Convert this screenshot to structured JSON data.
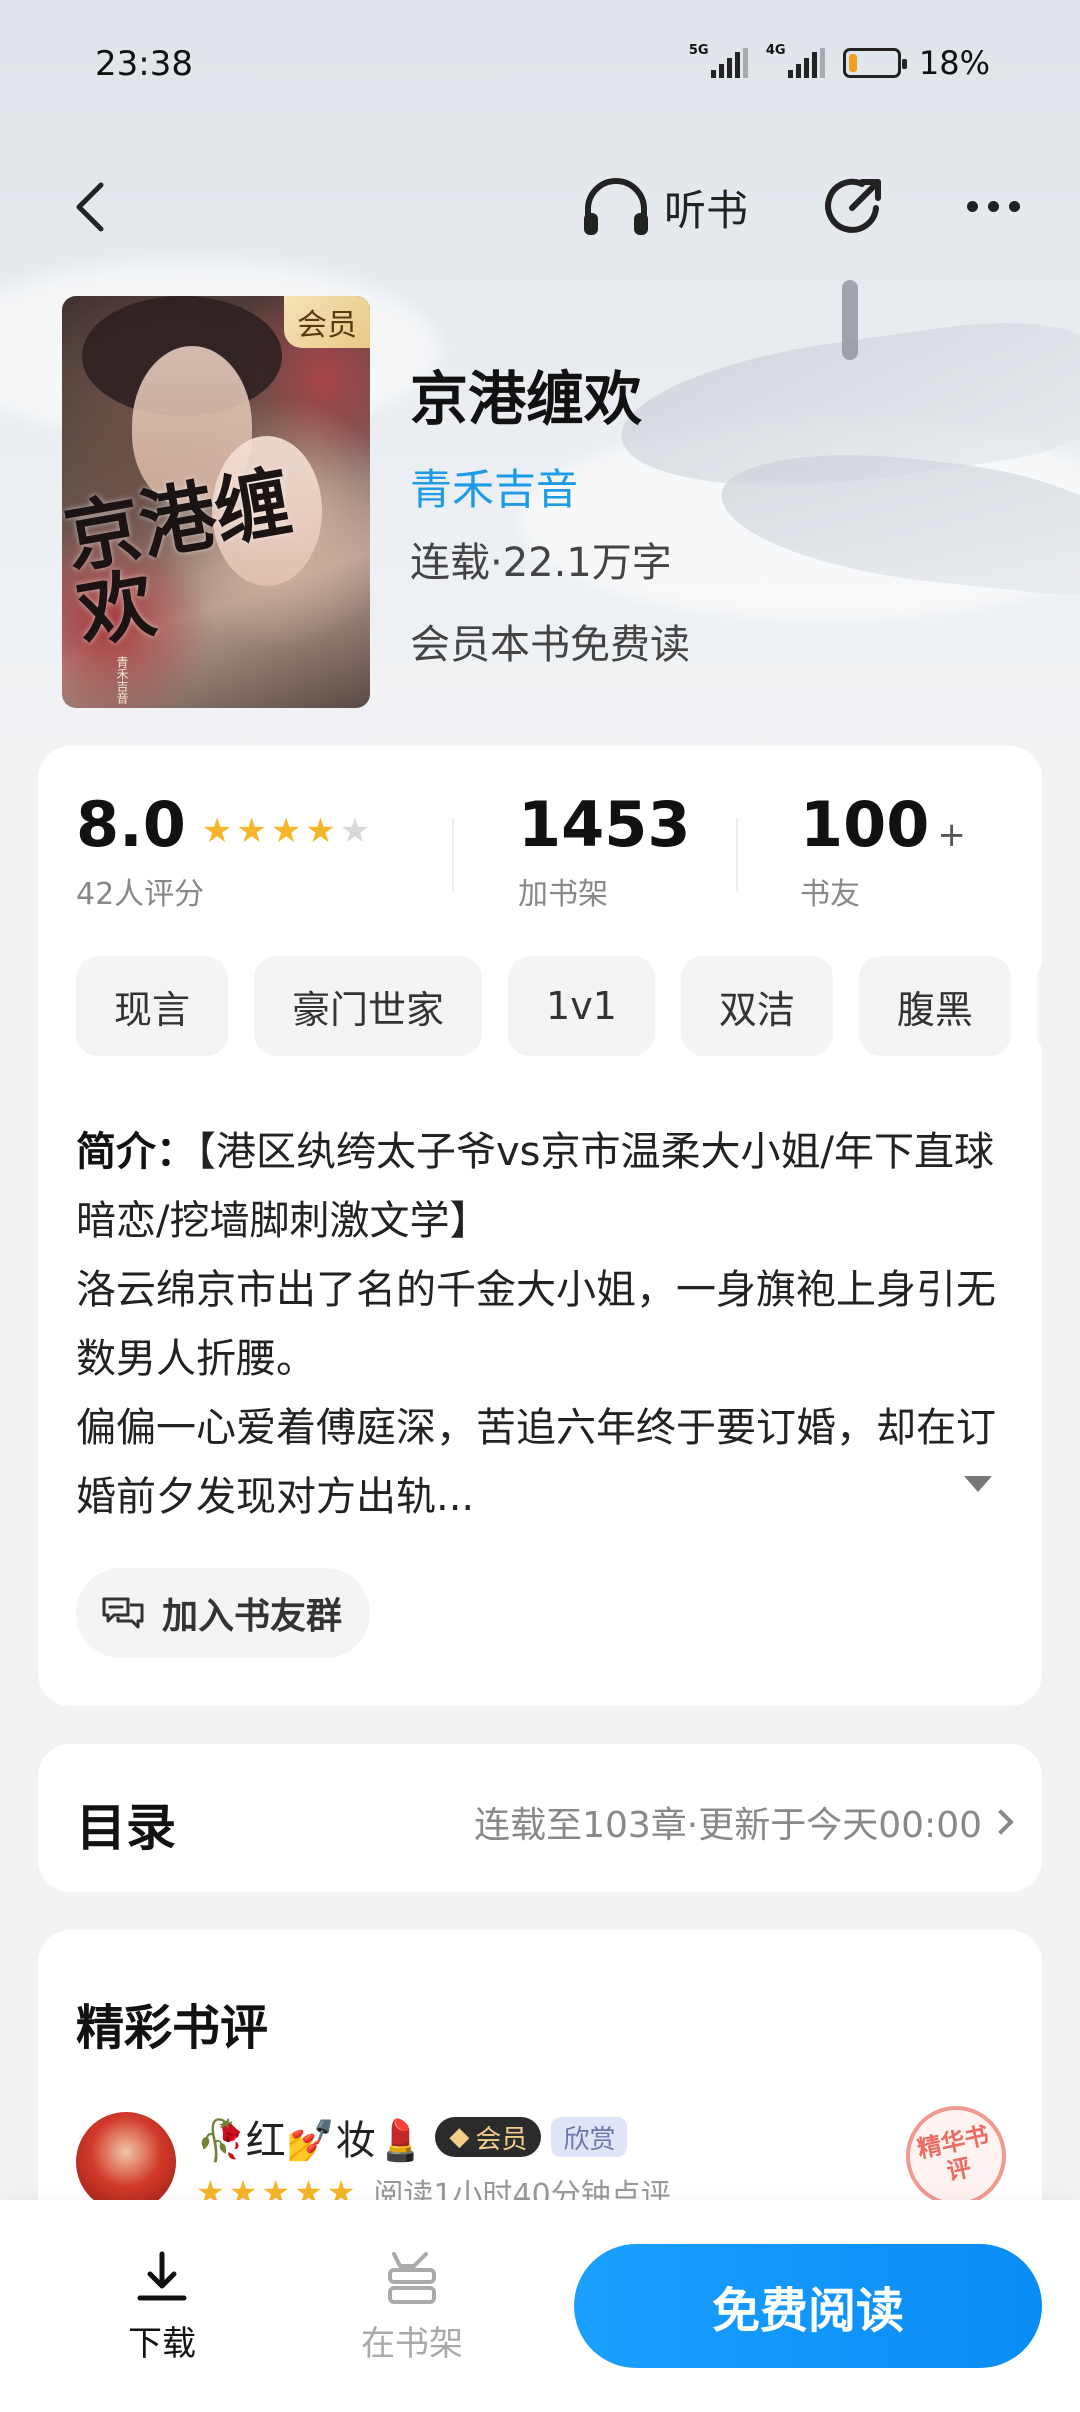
{
  "status_bar": {
    "time": "23:38",
    "signal1": "5G",
    "signal2": "4G",
    "battery": "18%",
    "battery_level": 0.18
  },
  "nav": {
    "listen_label": "听书",
    "back_icon": "chevron-left-icon",
    "share_icon": "share-icon",
    "more_icon": "more-icon"
  },
  "book": {
    "cover_vip_tag": "会员",
    "cover_title_text": "京港缠欢",
    "cover_author_text": "青禾吉音",
    "title": "京港缠欢",
    "author": "青禾吉音",
    "meta": "连载·22.1万字",
    "vip_note": "会员本书免费读"
  },
  "stats": {
    "rating": "8.0",
    "rating_stars": 4,
    "rating_label": "42人评分",
    "shelf_count": "1453",
    "shelf_label": "加书架",
    "friends_count": "100",
    "friends_plus": "+",
    "friends_label": "书友"
  },
  "tags": [
    "现言",
    "豪门世家",
    "1v1",
    "双洁",
    "腹黑"
  ],
  "intro": {
    "label": "简介：",
    "text": "【港区纨绔太子爷vs京市温柔大小姐/年下直球暗恋/挖墙脚刺激文学】\n洛云绵京市出了名的千金大小姐，一身旗袍上身引无数男人折腰。\n偏偏一心爱着傅庭深，苦追六年终于要订婚，却在订婚前夕发现对方出轨..."
  },
  "group_button": "加入书友群",
  "toc": {
    "title": "目录",
    "info": "连载至103章·更新于今天00:00"
  },
  "review": {
    "section_title": "精彩书评",
    "user_name": "🥀红💅妆💄",
    "vip_label": "会员",
    "badge": "欣赏",
    "stars": 5,
    "read_time": "阅读1小时40分钟点评",
    "stamp": "精华书评"
  },
  "bottom": {
    "download_label": "下载",
    "shelf_label": "在书架",
    "read_button": "免费阅读"
  },
  "colors": {
    "accent": "#1A9FFF",
    "author": "#1E9BE6",
    "star": "#F7B529"
  }
}
